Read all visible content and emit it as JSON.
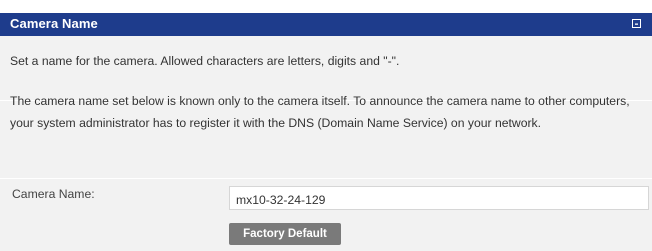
{
  "section": {
    "title": "Camera Name",
    "collapse_icon": "collapse-icon"
  },
  "body": {
    "intro": "Set a name for the camera. Allowed characters are letters, digits and \"-\".",
    "explanation": "The camera name set below is known only to the camera itself. To announce the camera name to other computers, your system administrator has to register it with the DNS (Domain Name Service) on your network."
  },
  "form": {
    "camera_name_label": "Camera Name:",
    "camera_name_value": "mx10-32-24-129",
    "factory_default_label": "Factory Default"
  },
  "colors": {
    "header_bg": "#1e3c8c",
    "body_bg": "#f2f2f2",
    "button_bg": "#7a7a7a"
  }
}
